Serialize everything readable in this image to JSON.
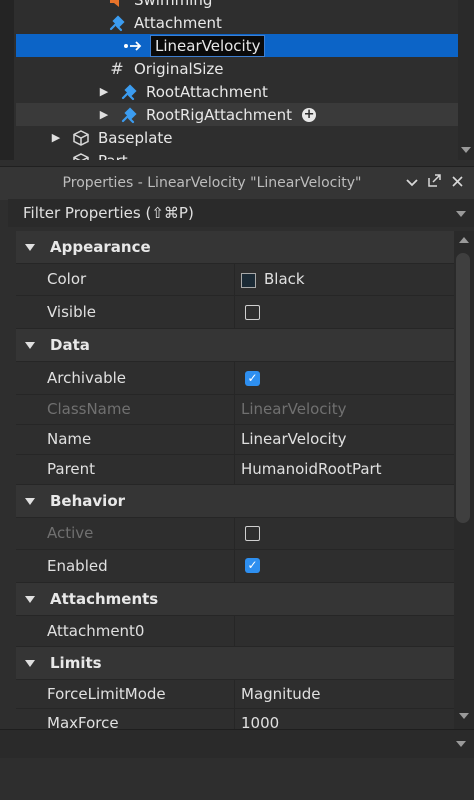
{
  "explorer": {
    "rows": [
      {
        "label": "Swimming",
        "icon": "sound-icon"
      },
      {
        "label": "Attachment",
        "icon": "attachment-icon"
      },
      {
        "label": "LinearVelocity",
        "icon": "linear-velocity-icon"
      },
      {
        "label": "OriginalSize",
        "icon": "hash-icon"
      },
      {
        "label": "RootAttachment",
        "icon": "attachment-icon"
      },
      {
        "label": "RootRigAttachment",
        "icon": "attachment-icon"
      },
      {
        "label": "Baseplate",
        "icon": "part-icon"
      },
      {
        "label": "Part",
        "icon": "part-icon"
      }
    ],
    "hash_glyph": "#",
    "add_glyph": "+"
  },
  "properties": {
    "title": "Properties - LinearVelocity \"LinearVelocity\"",
    "filter_placeholder": "Filter Properties (⇧⌘P)",
    "sections": {
      "appearance": "Appearance",
      "data": "Data",
      "behavior": "Behavior",
      "attachments": "Attachments",
      "limits": "Limits"
    },
    "rows": {
      "color": {
        "name": "Color",
        "value": "Black",
        "swatch": "#1b2a35"
      },
      "visible": {
        "name": "Visible",
        "checked": false
      },
      "archivable": {
        "name": "Archivable",
        "checked": true
      },
      "classname": {
        "name": "ClassName",
        "value": "LinearVelocity"
      },
      "name": {
        "name": "Name",
        "value": "LinearVelocity"
      },
      "parent": {
        "name": "Parent",
        "value": "HumanoidRootPart"
      },
      "active": {
        "name": "Active",
        "checked": false
      },
      "enabled": {
        "name": "Enabled",
        "checked": true
      },
      "attachment0": {
        "name": "Attachment0",
        "value": ""
      },
      "forcelimitmode": {
        "name": "ForceLimitMode",
        "value": "Magnitude"
      },
      "maxforce": {
        "name": "MaxForce",
        "value": "1000"
      }
    },
    "check_glyph": "✓"
  },
  "colors": {
    "selection": "#0c64c7",
    "accent_checkbox": "#2e8ff0",
    "attachment_icon": "#3b9cf0",
    "sound_icon": "#e8732a"
  }
}
